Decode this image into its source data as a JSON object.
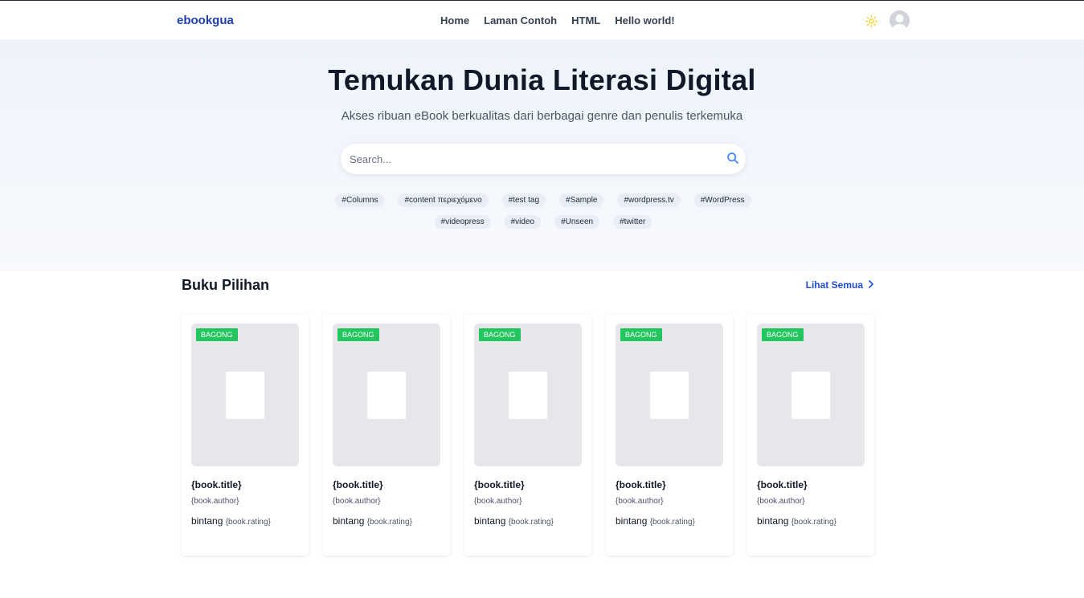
{
  "header": {
    "logo": "ebookgua",
    "nav": [
      "Home",
      "Laman Contoh",
      "HTML",
      "Hello world!"
    ]
  },
  "hero": {
    "title": "Temukan Dunia Literasi Digital",
    "subtitle": "Akses ribuan eBook berkualitas dari berbagai genre dan penulis terkemuka",
    "search_placeholder": "Search...",
    "tags": [
      "#Columns",
      "#content περιεχόμενο",
      "#test tag",
      "#Sample",
      "#wordpress.tv",
      "#WordPress",
      "#videopress",
      "#video",
      "#Unseen",
      "#twitter"
    ]
  },
  "featured": {
    "title": "Buku Pilihan",
    "see_all": "Lihat Semua",
    "books": [
      {
        "badge": "BAGONG",
        "title": "{book.title}",
        "author": "{book.author}",
        "rating_label": "bintang",
        "rating": "{book.rating}"
      },
      {
        "badge": "BAGONG",
        "title": "{book.title}",
        "author": "{book.author}",
        "rating_label": "bintang",
        "rating": "{book.rating}"
      },
      {
        "badge": "BAGONG",
        "title": "{book.title}",
        "author": "{book.author}",
        "rating_label": "bintang",
        "rating": "{book.rating}"
      },
      {
        "badge": "BAGONG",
        "title": "{book.title}",
        "author": "{book.author}",
        "rating_label": "bintang",
        "rating": "{book.rating}"
      },
      {
        "badge": "BAGONG",
        "title": "{book.title}",
        "author": "{book.author}",
        "rating_label": "bintang",
        "rating": "{book.rating}"
      }
    ]
  },
  "icons": {
    "theme": "sun-icon",
    "avatar": "user-avatar-icon",
    "search": "search-icon",
    "see_all": "chevron-right-icon"
  },
  "colors": {
    "brand": "#1e40af",
    "badge": "#22c55e",
    "sun": "#facc15"
  }
}
